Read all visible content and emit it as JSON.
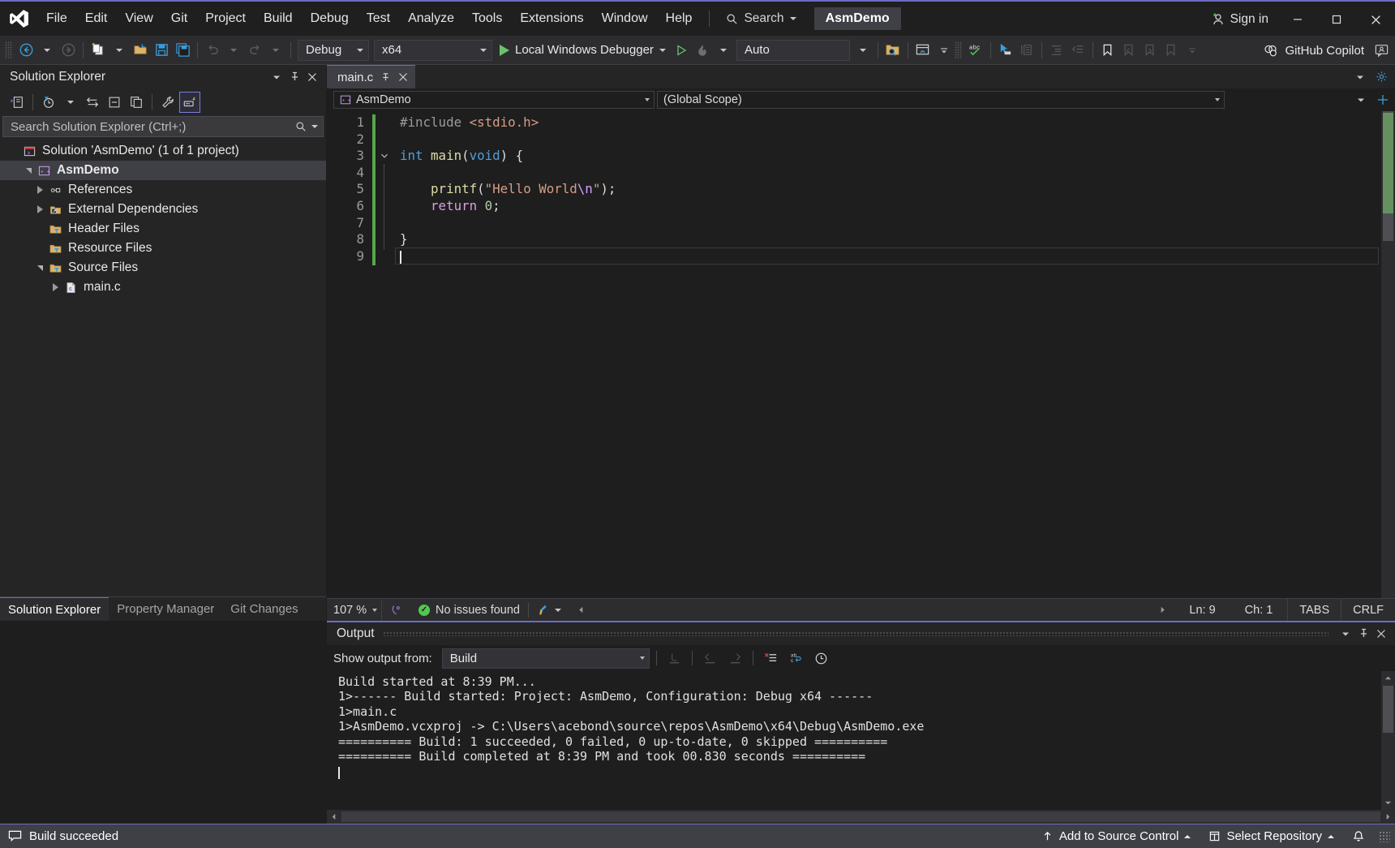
{
  "titlebar": {
    "logo": "visual-studio-logo",
    "menus": [
      "File",
      "Edit",
      "View",
      "Git",
      "Project",
      "Build",
      "Debug",
      "Test",
      "Analyze",
      "Tools",
      "Extensions",
      "Window",
      "Help"
    ],
    "search_label": "Search",
    "solution_name": "AsmDemo",
    "sign_in": "Sign in",
    "minimize": "—",
    "maximize": "□",
    "close": "✕"
  },
  "toolbar": {
    "configuration": "Debug",
    "platform": "x64",
    "start_debug": "Local Windows Debugger",
    "auto_label": "Auto",
    "copilot": "GitHub Copilot"
  },
  "solution_explorer": {
    "title": "Solution Explorer",
    "search_placeholder": "Search Solution Explorer (Ctrl+;)",
    "tree": [
      {
        "label": "Solution 'AsmDemo' (1 of 1 project)",
        "icon": "solution-icon",
        "indent": 0,
        "twist": "none",
        "bold": false,
        "selected": false
      },
      {
        "label": "AsmDemo",
        "icon": "cpp-project-icon",
        "indent": 1,
        "twist": "open",
        "bold": true,
        "selected": true
      },
      {
        "label": "References",
        "icon": "references-icon",
        "indent": 2,
        "twist": "closed",
        "bold": false,
        "selected": false
      },
      {
        "label": "External Dependencies",
        "icon": "external-deps-icon",
        "indent": 2,
        "twist": "closed",
        "bold": false,
        "selected": false
      },
      {
        "label": "Header Files",
        "icon": "filter-folder-icon",
        "indent": 2,
        "twist": "none",
        "bold": false,
        "selected": false
      },
      {
        "label": "Resource Files",
        "icon": "filter-folder-icon",
        "indent": 2,
        "twist": "none",
        "bold": false,
        "selected": false
      },
      {
        "label": "Source Files",
        "icon": "filter-folder-icon",
        "indent": 2,
        "twist": "open",
        "bold": false,
        "selected": false
      },
      {
        "label": "main.c",
        "icon": "c-file-icon",
        "indent": 3,
        "twist": "closed",
        "bold": false,
        "selected": false
      }
    ],
    "tabs": [
      {
        "label": "Solution Explorer",
        "active": true
      },
      {
        "label": "Property Manager",
        "active": false
      },
      {
        "label": "Git Changes",
        "active": false
      }
    ]
  },
  "editor": {
    "tab_label": "main.c",
    "project_scope": "AsmDemo",
    "member_scope": "(Global Scope)",
    "line_numbers": [
      "1",
      "2",
      "3",
      "4",
      "5",
      "6",
      "7",
      "8",
      "9"
    ],
    "code_lines": [
      {
        "n": 1,
        "tokens": [
          {
            "t": "#include ",
            "c": "k-pre"
          },
          {
            "t": "<stdio.h>",
            "c": "k-inc"
          }
        ]
      },
      {
        "n": 2,
        "tokens": []
      },
      {
        "n": 3,
        "tokens": [
          {
            "t": "int ",
            "c": "k-kw"
          },
          {
            "t": "main",
            "c": "k-fn"
          },
          {
            "t": "(",
            "c": "k-punc"
          },
          {
            "t": "void",
            "c": "k-kw"
          },
          {
            "t": ") {",
            "c": "k-punc"
          }
        ]
      },
      {
        "n": 4,
        "tokens": []
      },
      {
        "n": 5,
        "tokens": [
          {
            "t": "    ",
            "c": "k-plain"
          },
          {
            "t": "printf",
            "c": "k-fn"
          },
          {
            "t": "(",
            "c": "k-punc"
          },
          {
            "t": "\"Hello World",
            "c": "k-str"
          },
          {
            "t": "\\n",
            "c": "k-esc"
          },
          {
            "t": "\"",
            "c": "k-str"
          },
          {
            "t": ");",
            "c": "k-punc"
          }
        ]
      },
      {
        "n": 6,
        "tokens": [
          {
            "t": "    ",
            "c": "k-plain"
          },
          {
            "t": "return ",
            "c": "k-ret"
          },
          {
            "t": "0",
            "c": "k-num"
          },
          {
            "t": ";",
            "c": "k-punc"
          }
        ]
      },
      {
        "n": 7,
        "tokens": []
      },
      {
        "n": 8,
        "tokens": [
          {
            "t": "}",
            "c": "k-punc"
          }
        ]
      },
      {
        "n": 9,
        "tokens": []
      }
    ],
    "status": {
      "zoom": "107 %",
      "issues": "No issues found",
      "line": "Ln: 9",
      "col": "Ch: 1",
      "tabs_mode": "TABS",
      "line_endings": "CRLF"
    }
  },
  "output": {
    "title": "Output",
    "show_from_label": "Show output from:",
    "source": "Build",
    "lines": [
      "Build started at 8:39 PM...",
      "1>------ Build started: Project: AsmDemo, Configuration: Debug x64 ------",
      "1>main.c",
      "1>AsmDemo.vcxproj -> C:\\Users\\acebond\\source\\repos\\AsmDemo\\x64\\Debug\\AsmDemo.exe",
      "========== Build: 1 succeeded, 0 failed, 0 up-to-date, 0 skipped ==========",
      "========== Build completed at 8:39 PM and took 00.830 seconds =========="
    ]
  },
  "statusbar": {
    "build_status": "Build succeeded",
    "add_to_source_control": "Add to Source Control",
    "select_repository": "Select Repository"
  },
  "colors": {
    "accent": "#6c6cc4",
    "chrome": "#2d2d30",
    "editor_bg": "#1e1e1e",
    "success_green": "#57a64a",
    "status_bar": "#3f3f46"
  }
}
